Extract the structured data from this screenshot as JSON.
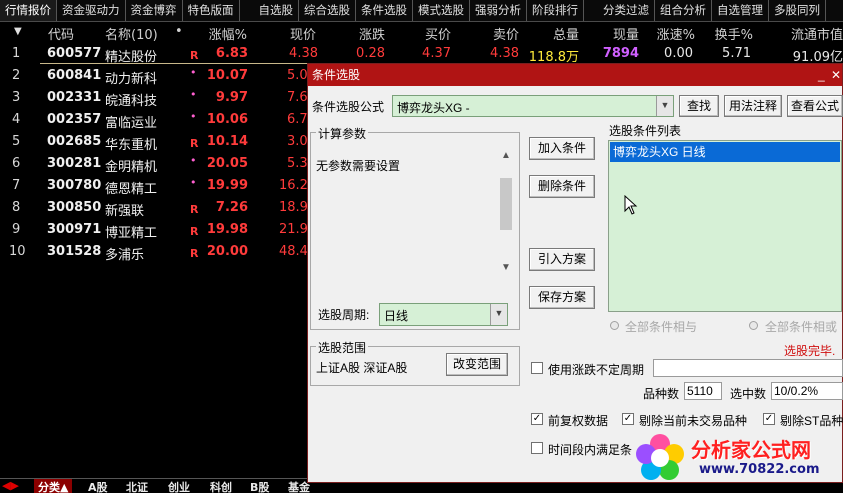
{
  "top_tabs": [
    "行情报价",
    "资金驱动力",
    "资金博弈",
    "特色版面",
    "自选股",
    "综合选股",
    "条件选股",
    "模式选股",
    "强弱分析",
    "阶段排行",
    "分类过滤",
    "组合分析",
    "自选管理",
    "多股同列"
  ],
  "columns": {
    "code": "代码",
    "name": "名称(10)",
    "dot": "•",
    "pct": "涨幅%",
    "price": "现价",
    "chg": "涨跌",
    "buy": "买价",
    "sell": "卖价",
    "vol": "总量",
    "cur": "现量",
    "speed": "涨速%",
    "turn": "换手%",
    "mcap": "流通市值"
  },
  "rows": [
    {
      "idx": "1",
      "code": "600577",
      "name": "精达股份",
      "flag": "R",
      "pct": "6.83",
      "price": "4.38",
      "chg": "0.28",
      "buy": "4.37",
      "sell": "4.38",
      "vol": "118.8万",
      "cur": "7894",
      "speed": "0.00",
      "turn": "5.71",
      "mcap": "91.09亿"
    },
    {
      "idx": "2",
      "code": "600841",
      "name": "动力新科",
      "flag": "•",
      "pct": "10.07",
      "price": "5.0"
    },
    {
      "idx": "3",
      "code": "002331",
      "name": "皖通科技",
      "flag": "•",
      "pct": "9.97",
      "price": "7.6"
    },
    {
      "idx": "4",
      "code": "002357",
      "name": "富临运业",
      "flag": "•",
      "pct": "10.06",
      "price": "6.7"
    },
    {
      "idx": "5",
      "code": "002685",
      "name": "华东重机",
      "flag": "R",
      "pct": "10.14",
      "price": "3.0"
    },
    {
      "idx": "6",
      "code": "300281",
      "name": "金明精机",
      "flag": "•",
      "pct": "20.05",
      "price": "5.3"
    },
    {
      "idx": "7",
      "code": "300780",
      "name": "德恩精工",
      "flag": "•",
      "pct": "19.99",
      "price": "16.2"
    },
    {
      "idx": "8",
      "code": "300850",
      "name": "新强联",
      "flag": "R",
      "pct": "7.26",
      "price": "18.9"
    },
    {
      "idx": "9",
      "code": "300971",
      "name": "博亚精工",
      "flag": "R",
      "pct": "19.98",
      "price": "21.9"
    },
    {
      "idx": "10",
      "code": "301528",
      "name": "多浦乐",
      "flag": "R",
      "pct": "20.00",
      "price": "48.4"
    }
  ],
  "bottom_tabs": [
    "分类▲",
    "A股",
    "北证",
    "创业",
    "科创",
    "B股",
    "基金"
  ],
  "dialog": {
    "title": "条件选股",
    "formula_label": "条件选股公式",
    "formula_value": "博弈龙头XG  -",
    "find_btn": "查找",
    "usage_btn": "用法注释",
    "view_btn": "查看公式",
    "params_group": "计算参数",
    "params_text": "无参数需要设置",
    "add_btn": "加入条件",
    "del_btn": "删除条件",
    "import_btn": "引入方案",
    "save_btn": "保存方案",
    "list_label": "选股条件列表",
    "list_item": "博弈龙头XG  日线",
    "period_label": "选股周期:",
    "period_value": "日线",
    "radio_and": "全部条件相与",
    "radio_or": "全部条件相或",
    "status": "选股完毕.",
    "range_group": "选股范围",
    "range_text": "上证A股 深证A股",
    "change_range_btn": "改变范围",
    "use_var_period": "使用涨跌不定周期",
    "count_label": "品种数",
    "count_value": "5110",
    "selected_label": "选中数",
    "selected_value": "10/0.2%",
    "chk_fq": "前复权数据",
    "chk_exclude_untrade": "剔除当前未交易品种",
    "chk_exclude_st": "剔除ST品种",
    "chk_time_range": "时间段内满足条"
  },
  "watermark": {
    "title": "分析家公式网",
    "url": "www.70822.com"
  },
  "colors": {
    "red": "#ff3b3b",
    "yellow": "#ffeb3b",
    "purple": "#d060ff",
    "title_red": "#b01414",
    "list_green": "#d6f0d6",
    "selection_blue": "#0a6ad6"
  }
}
